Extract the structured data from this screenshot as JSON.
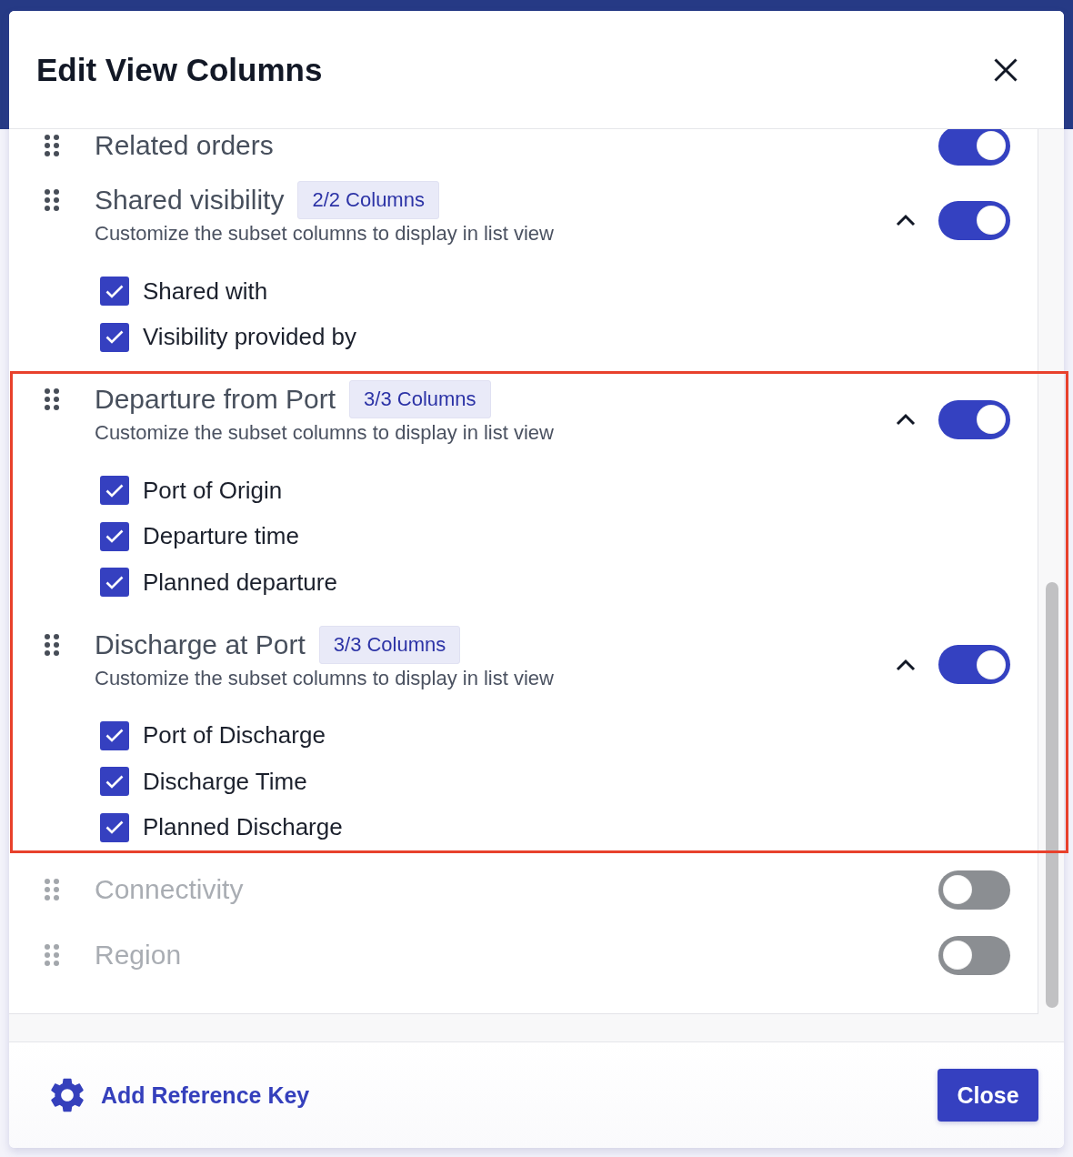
{
  "dialog": {
    "title": "Edit View Columns"
  },
  "groups": [
    {
      "title": "Related orders",
      "on": true,
      "highlighted": false
    },
    {
      "title": "Shared visibility",
      "badge": "2/2 Columns",
      "subtitle": "Customize the subset columns to display in list view",
      "expanded": true,
      "on": true,
      "highlighted": false,
      "columns": [
        {
          "label": "Shared with",
          "checked": true
        },
        {
          "label": "Visibility provided by",
          "checked": true
        }
      ]
    },
    {
      "title": "Departure from Port",
      "badge": "3/3 Columns",
      "subtitle": "Customize the subset columns to display in list view",
      "expanded": true,
      "on": true,
      "highlighted": true,
      "columns": [
        {
          "label": "Port of Origin",
          "checked": true
        },
        {
          "label": "Departure time",
          "checked": true
        },
        {
          "label": "Planned departure",
          "checked": true
        }
      ]
    },
    {
      "title": "Discharge at Port",
      "badge": "3/3 Columns",
      "subtitle": "Customize the subset columns to display in list view",
      "expanded": true,
      "on": true,
      "highlighted": true,
      "columns": [
        {
          "label": "Port of Discharge",
          "checked": true
        },
        {
          "label": "Discharge Time",
          "checked": true
        },
        {
          "label": "Planned Discharge",
          "checked": true
        }
      ]
    },
    {
      "title": "Connectivity",
      "on": false,
      "highlighted": false
    },
    {
      "title": "Region",
      "on": false,
      "highlighted": false
    }
  ],
  "footer": {
    "link": "Add Reference Key",
    "button": "Close"
  }
}
